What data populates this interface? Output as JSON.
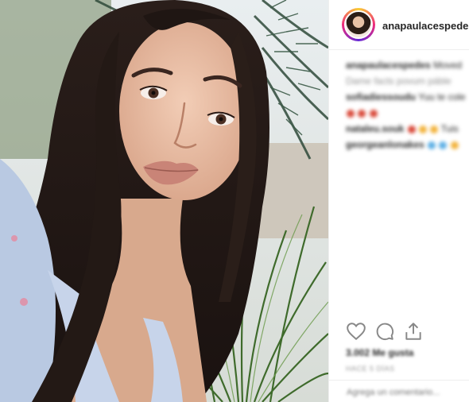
{
  "post": {
    "username": "anapaulacespedes",
    "caption_user": "anapaulacespedes",
    "caption_text": "Moved",
    "caption_text2": "Dame facts povum páble"
  },
  "comments": [
    {
      "user": "sofiadiessoudu",
      "text": "Yuu te cole"
    },
    {
      "user": "",
      "text": ""
    },
    {
      "user": "nataleu.souk",
      "text": "Tuis"
    },
    {
      "user": "georgeanlonakes",
      "text": ""
    }
  ],
  "likes": "3.002 Me gusta",
  "date": "HACE 5 DÍAS",
  "add_comment_placeholder": "Agrega un comentario...",
  "icons": {
    "like": "heart-icon",
    "comment": "comment-bubble-icon",
    "share": "share-icon"
  },
  "colors": {
    "accent": "#262626",
    "muted": "#999999",
    "divider": "#efefef",
    "emoji_red": "#d94a3a",
    "emoji_yellow": "#f2b33d",
    "emoji_blue": "#5fb0e5"
  }
}
